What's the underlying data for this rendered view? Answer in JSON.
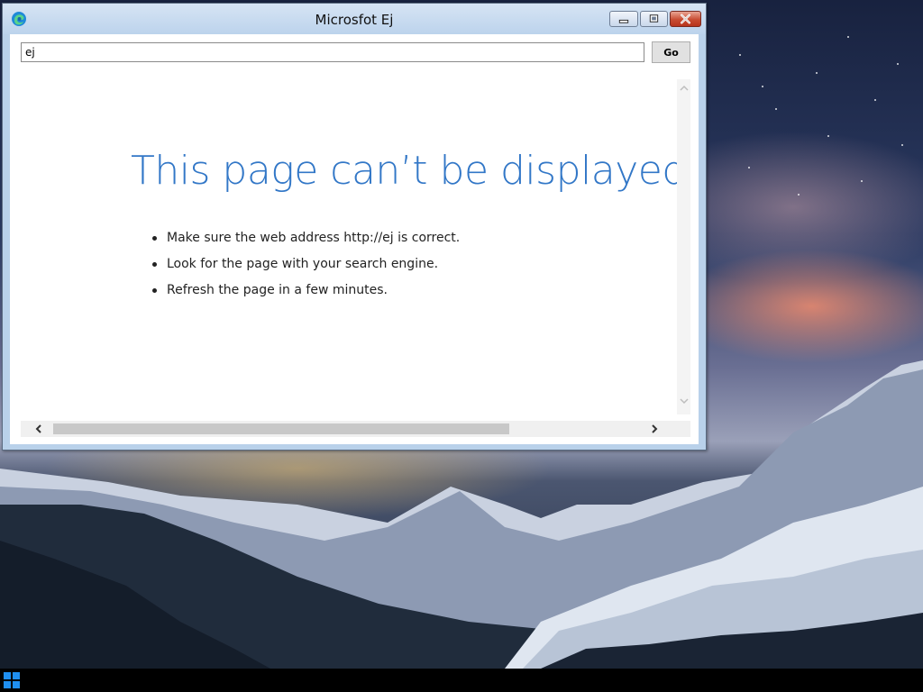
{
  "window": {
    "title": "Microsfot Ej"
  },
  "toolbar": {
    "address_value": "ej",
    "go_label": "Go"
  },
  "error_page": {
    "heading": "This page can’t be displayed",
    "suggestions": [
      "Make sure the web address http://ej is correct.",
      "Look for the page with your search engine.",
      "Refresh the page in a few minutes."
    ]
  },
  "icons": {
    "app": "edge-icon",
    "minimize": "minimize-icon",
    "maximize": "maximize-icon",
    "close": "close-icon",
    "scroll_up": "chevron-up-icon",
    "scroll_down": "chevron-down-icon",
    "scroll_left": "chevron-left-icon",
    "scroll_right": "chevron-right-icon",
    "start": "windows-start-icon"
  },
  "colors": {
    "heading": "#3277c7",
    "window_frame": "#b9d1ea",
    "close_button": "#c84c32",
    "taskbar": "#000000",
    "start_button": "#1f8ff0"
  }
}
